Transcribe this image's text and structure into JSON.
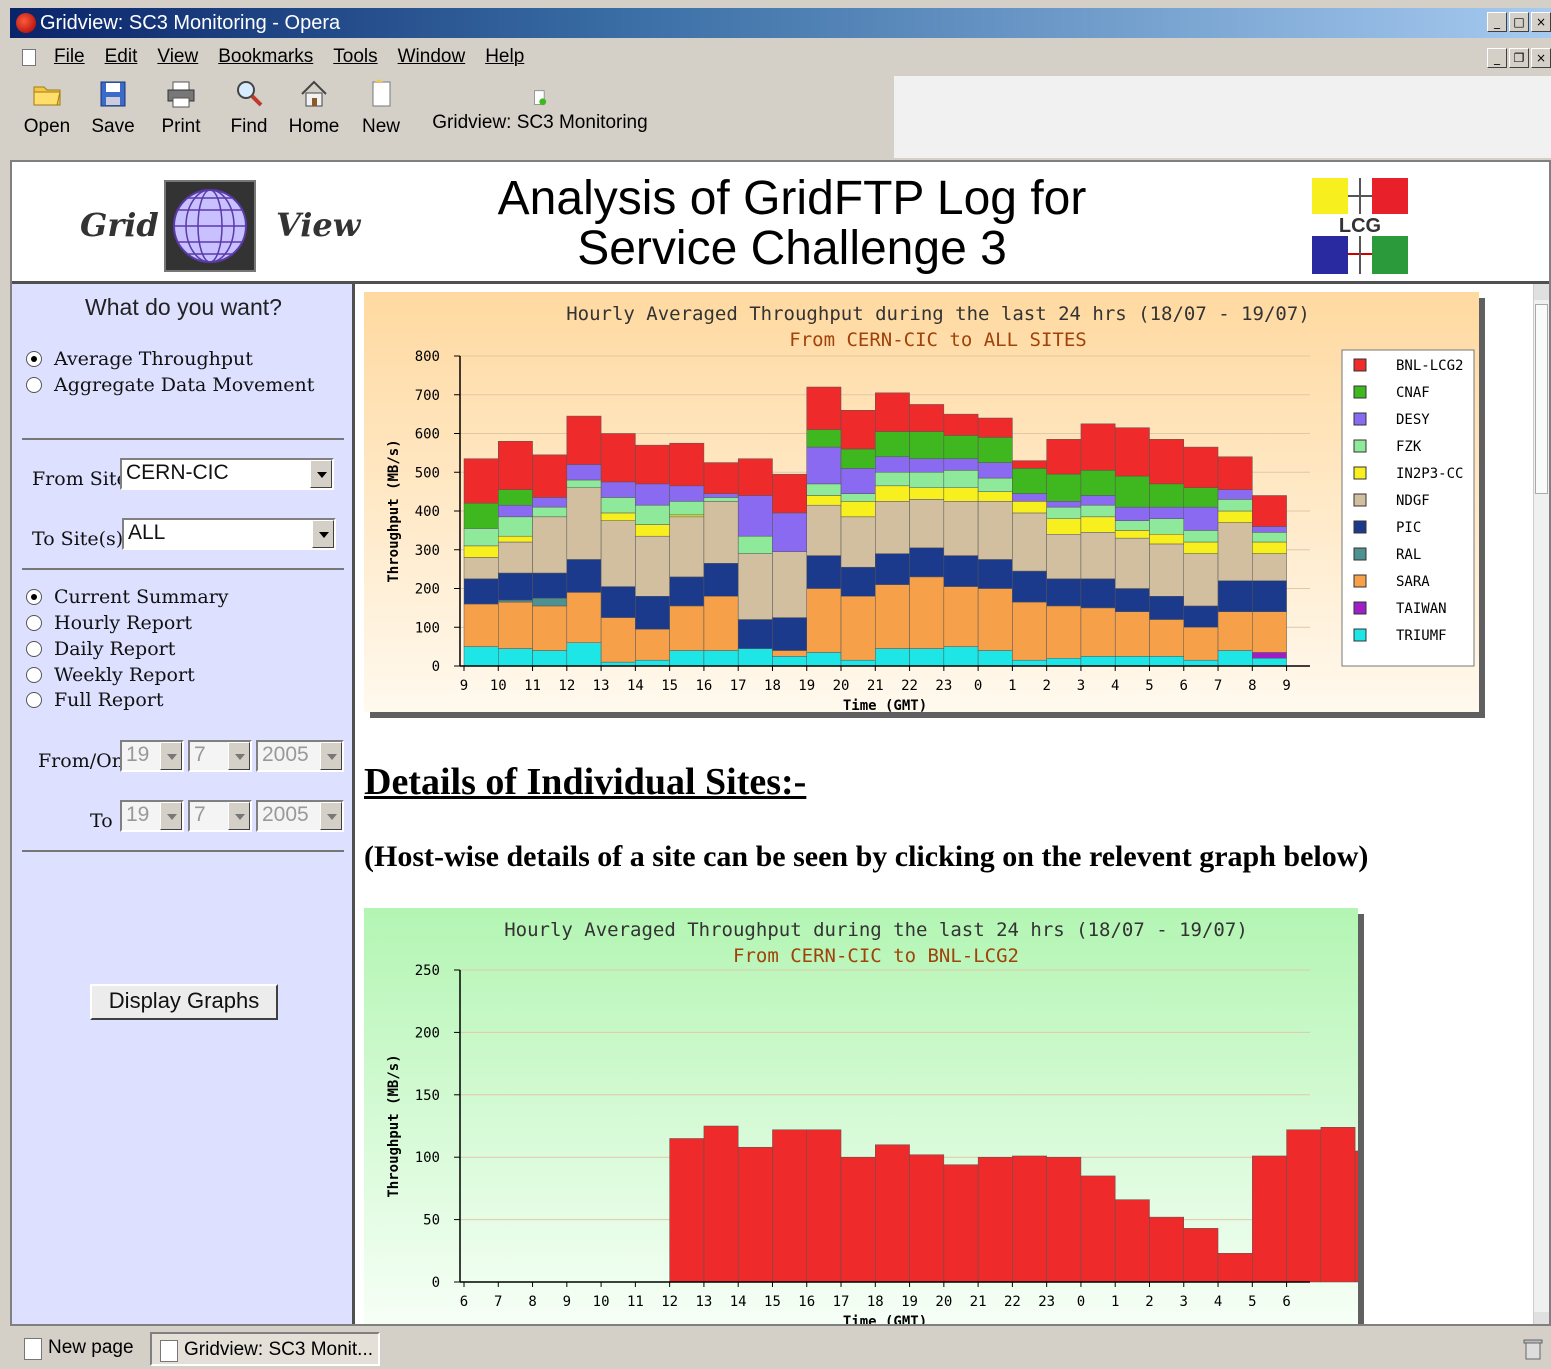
{
  "window": {
    "title": "Gridview: SC3 Monitoring - Opera"
  },
  "menu": [
    "File",
    "Edit",
    "View",
    "Bookmarks",
    "Tools",
    "Window",
    "Help"
  ],
  "toolbar": {
    "buttons": [
      {
        "label": "Open",
        "icon": "folder-icon"
      },
      {
        "label": "Save",
        "icon": "floppy-icon"
      },
      {
        "label": "Print",
        "icon": "printer-icon"
      },
      {
        "label": "Find",
        "icon": "magnifier-icon"
      },
      {
        "label": "Home",
        "icon": "home-icon"
      },
      {
        "label": "New",
        "icon": "new-page-icon"
      }
    ],
    "page_tab": "Gridview: SC3 Monitoring"
  },
  "banner": {
    "logo_left": "Grid",
    "logo_right": "View",
    "title_line1": "Analysis of GridFTP Log for",
    "title_line2": "Service Challenge 3",
    "lcg_label": "LCG"
  },
  "sidebar": {
    "question": "What do you want?",
    "mode_options": [
      {
        "label": "Average Throughput",
        "selected": true
      },
      {
        "label": "Aggregate Data Movement",
        "selected": false
      }
    ],
    "from_site_label": "From Site",
    "from_site_value": "CERN-CIC",
    "to_sites_label": "To Site(s)",
    "to_sites_value": "ALL",
    "report_options": [
      {
        "label": "Current Summary",
        "selected": true
      },
      {
        "label": "Hourly Report",
        "selected": false
      },
      {
        "label": "Daily Report",
        "selected": false
      },
      {
        "label": "Weekly Report",
        "selected": false
      },
      {
        "label": "Full Report",
        "selected": false
      }
    ],
    "from_on_label": "From/On",
    "from_on": {
      "day": "19",
      "month": "7",
      "year": "2005"
    },
    "to_label": "To",
    "to": {
      "day": "19",
      "month": "7",
      "year": "2005"
    },
    "display_button": "Display Graphs"
  },
  "main": {
    "details_heading": "Details of Individual Sites:-",
    "details_sub": "(Host-wise details of a site can be seen by clicking on the relevent graph below)"
  },
  "statusbar": {
    "tab1": "New page",
    "tab2": "Gridview: SC3 Monit..."
  },
  "colors": {
    "BNL-LCG2": "#ee2a2a",
    "CNAF": "#3fb81f",
    "DESY": "#8a6af0",
    "FZK": "#8eea9a",
    "IN2P3-CC": "#f7f01e",
    "NDGF": "#d2bfa0",
    "PIC": "#1c3a8c",
    "RAL": "#4d9190",
    "SARA": "#f6a04a",
    "TAIWAN": "#a01ec8",
    "TRIUMF": "#1ee6e6"
  },
  "chart_data": [
    {
      "type": "bar",
      "stacked": true,
      "title": "Hourly Averaged Throughput during the last 24 hrs (18/07 - 19/07)",
      "subtitle": "From CERN-CIC to ALL SITES",
      "xlabel": "Time (GMT)",
      "ylabel": "Throughput (MB/s)",
      "ylim": [
        0,
        800
      ],
      "yticks": [
        0,
        100,
        200,
        300,
        400,
        500,
        600,
        700,
        800
      ],
      "legend_position": "right",
      "categories": [
        "9",
        "10",
        "11",
        "12",
        "13",
        "14",
        "15",
        "16",
        "17",
        "18",
        "19",
        "20",
        "21",
        "22",
        "23",
        "0",
        "1",
        "2",
        "3",
        "4",
        "5",
        "6",
        "7",
        "8",
        "9"
      ],
      "series": [
        {
          "name": "TRIUMF",
          "values": [
            50,
            45,
            40,
            60,
            10,
            15,
            40,
            40,
            45,
            25,
            35,
            15,
            45,
            45,
            50,
            40,
            15,
            20,
            25,
            25,
            25,
            15,
            40,
            20
          ]
        },
        {
          "name": "TAIWAN",
          "values": [
            0,
            0,
            0,
            0,
            0,
            0,
            0,
            0,
            0,
            0,
            0,
            0,
            0,
            0,
            0,
            0,
            0,
            0,
            0,
            0,
            0,
            0,
            0,
            15
          ]
        },
        {
          "name": "SARA",
          "values": [
            110,
            120,
            115,
            130,
            115,
            80,
            115,
            140,
            0,
            15,
            165,
            165,
            165,
            185,
            155,
            160,
            150,
            135,
            125,
            115,
            95,
            85,
            100,
            105
          ]
        },
        {
          "name": "RAL",
          "values": [
            0,
            5,
            20,
            0,
            0,
            0,
            0,
            0,
            0,
            0,
            0,
            0,
            0,
            0,
            0,
            0,
            0,
            0,
            0,
            0,
            0,
            0,
            0,
            0
          ]
        },
        {
          "name": "PIC",
          "values": [
            65,
            70,
            65,
            85,
            80,
            85,
            75,
            85,
            75,
            85,
            85,
            75,
            80,
            75,
            80,
            75,
            80,
            70,
            75,
            60,
            60,
            55,
            80,
            80
          ]
        },
        {
          "name": "NDGF",
          "values": [
            55,
            80,
            145,
            185,
            170,
            155,
            155,
            160,
            170,
            170,
            130,
            130,
            135,
            125,
            140,
            150,
            150,
            115,
            120,
            130,
            135,
            135,
            150,
            70
          ]
        },
        {
          "name": "IN2P3-CC",
          "values": [
            30,
            15,
            0,
            0,
            20,
            30,
            5,
            0,
            0,
            0,
            25,
            40,
            40,
            30,
            35,
            25,
            30,
            40,
            40,
            20,
            25,
            30,
            30,
            30
          ]
        },
        {
          "name": "FZK",
          "values": [
            45,
            50,
            25,
            20,
            40,
            50,
            35,
            10,
            45,
            0,
            30,
            20,
            35,
            40,
            45,
            35,
            0,
            30,
            30,
            25,
            40,
            30,
            30,
            25
          ]
        },
        {
          "name": "DESY",
          "values": [
            0,
            30,
            25,
            40,
            40,
            55,
            40,
            10,
            105,
            100,
            95,
            65,
            40,
            35,
            30,
            40,
            20,
            15,
            25,
            35,
            30,
            60,
            25,
            15
          ]
        },
        {
          "name": "CNAF",
          "values": [
            65,
            40,
            0,
            0,
            0,
            0,
            0,
            0,
            0,
            0,
            45,
            50,
            65,
            70,
            60,
            65,
            65,
            70,
            65,
            80,
            60,
            50,
            0,
            0
          ]
        },
        {
          "name": "BNL-LCG2",
          "values": [
            115,
            125,
            110,
            125,
            125,
            100,
            110,
            80,
            95,
            100,
            110,
            100,
            100,
            70,
            55,
            50,
            20,
            90,
            120,
            125,
            115,
            105,
            85,
            80
          ]
        }
      ]
    },
    {
      "type": "bar",
      "title": "Hourly Averaged Throughput during the last 24 hrs (18/07 - 19/07)",
      "subtitle": "From CERN-CIC to BNL-LCG2",
      "xlabel": "Time (GMT)",
      "ylabel": "Throughput (MB/s)",
      "ylim": [
        0,
        250
      ],
      "yticks": [
        0,
        50,
        100,
        150,
        200,
        250
      ],
      "categories": [
        "6",
        "7",
        "8",
        "9",
        "10",
        "11",
        "12",
        "13",
        "14",
        "15",
        "16",
        "17",
        "18",
        "19",
        "20",
        "21",
        "22",
        "23",
        "0",
        "1",
        "2",
        "3",
        "4",
        "5",
        "6"
      ],
      "series": [
        {
          "name": "BNL-LCG2",
          "values": [
            0,
            0,
            0,
            115,
            125,
            108,
            122,
            122,
            100,
            110,
            102,
            94,
            100,
            101,
            100,
            85,
            66,
            52,
            43,
            23,
            101,
            122,
            124,
            105
          ]
        }
      ]
    }
  ]
}
